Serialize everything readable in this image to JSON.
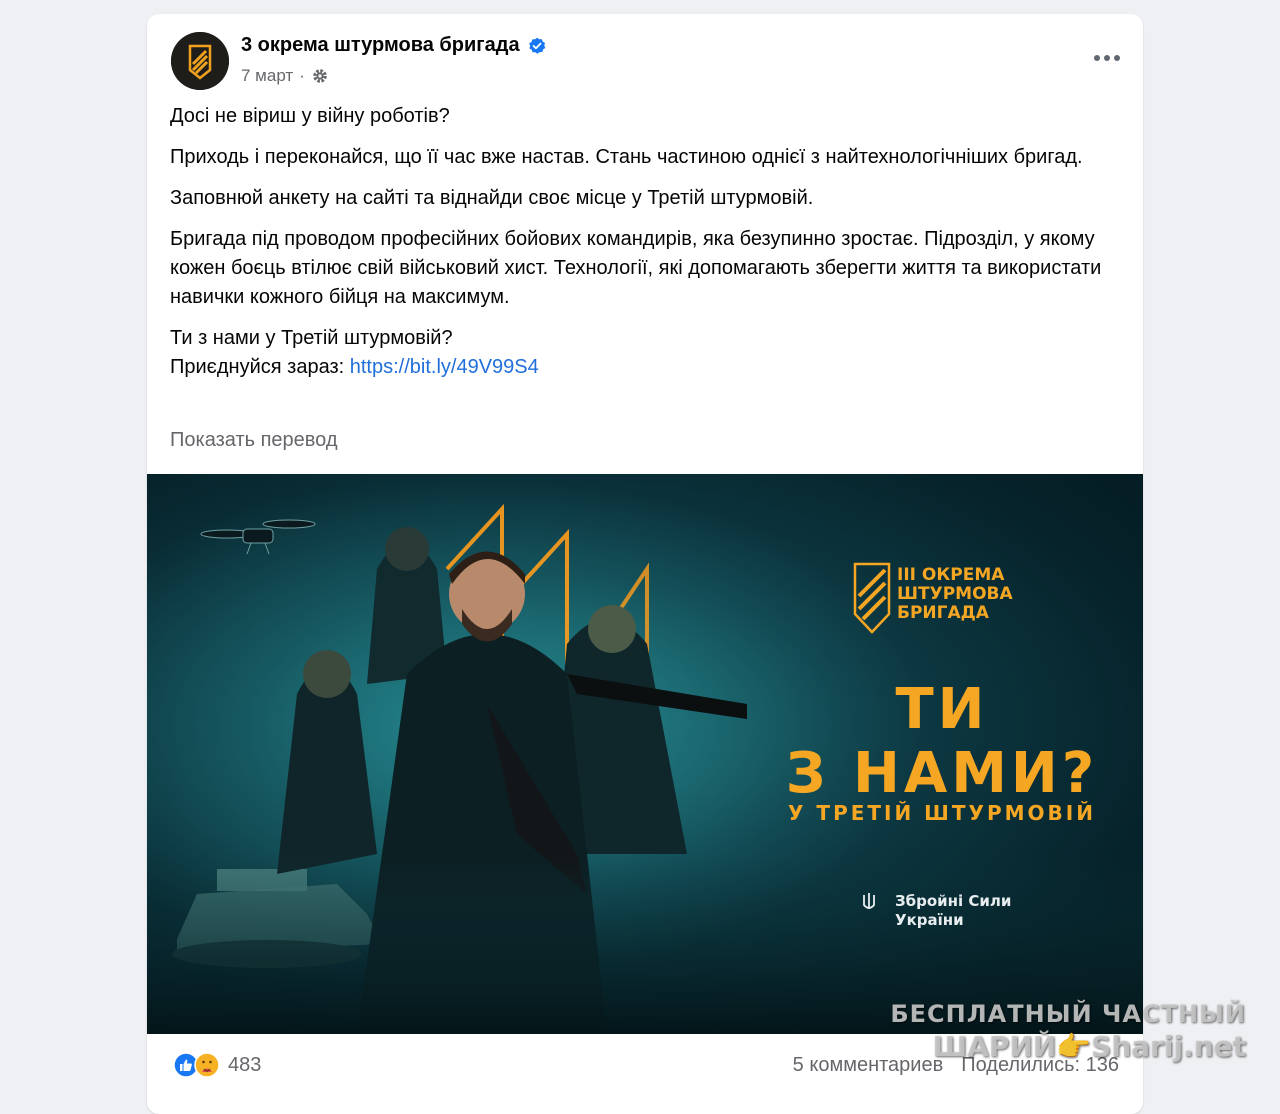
{
  "post": {
    "page_name": "3 окрема штурмова бригада",
    "date": "7 март",
    "dot": "·",
    "paragraphs": [
      "Досі не віриш у війну роботів?",
      "Приходь і переконайся, що її час вже настав. Стань частиною однієї з найтехнологічніших бригад.",
      "Заповнюй анкету на сайті та віднайди своє місце у Третій штурмовій.",
      "Бригада під проводом професійних бойових командирів, яка безупинно зростає. Підрозділ, у якому кожен боєць втілює свій військовий хист. Технології, які допомагають зберегти життя та використати навички кожного бійця на максимум."
    ],
    "closing_line": "Ти з нами у Третій штурмовій?",
    "cta_prefix": "Приєднуйся зараз: ",
    "cta_link": "https://bit.ly/49V99S4",
    "show_translation": "Показать перевод"
  },
  "banner": {
    "brand_lines": [
      "III ОКРЕМА",
      "ШТУРМОВА",
      "БРИГАДА"
    ],
    "headline_1": "ТИ",
    "headline_2": "З НАМИ?",
    "subline": "У ТРЕТІЙ ШТУРМОВІЙ",
    "army_line_1": "Збройні Сили",
    "army_line_2": "України"
  },
  "footer": {
    "reaction_count": "483",
    "comments": "5 комментариев",
    "shares": "Поделились: 136"
  },
  "watermark": {
    "line1": "БЕСПЛАТНЫЙ  ЧАСТНЫЙ",
    "line2": "ШАРИЙ👉Sharij.net"
  },
  "icons": {
    "verified": "verified-badge-icon",
    "privacy": "gear-icon",
    "more": "more-options-icon",
    "like": "like-icon",
    "care": "care-icon"
  },
  "colors": {
    "accent_orange": "#f5a623",
    "link": "#216fdb",
    "verified": "#1877f2"
  }
}
